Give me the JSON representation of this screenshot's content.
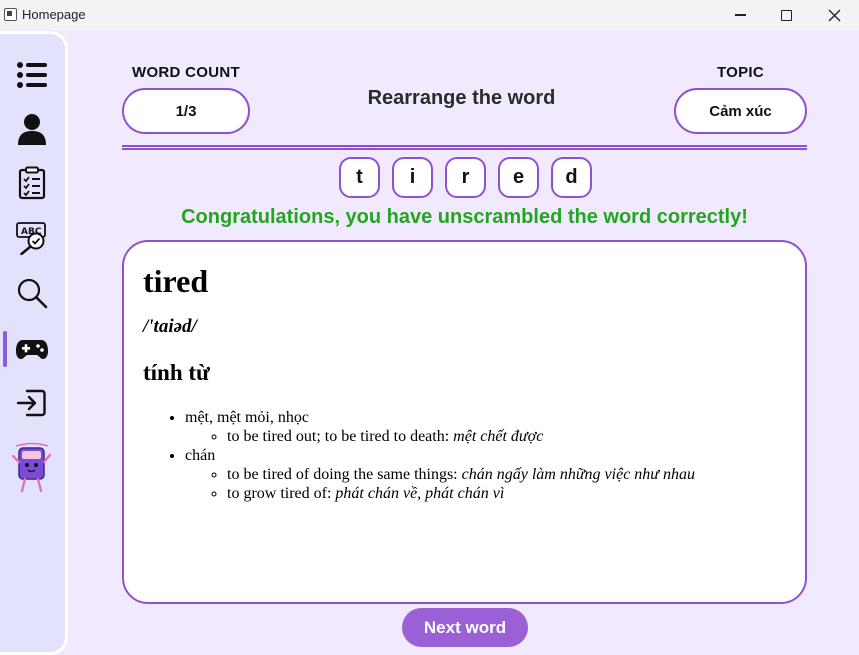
{
  "window": {
    "title": "Homepage"
  },
  "sidebar": {
    "items": [
      {
        "icon": "menu-list-icon"
      },
      {
        "icon": "user-icon"
      },
      {
        "icon": "clipboard-checklist-icon"
      },
      {
        "icon": "spell-check-icon"
      },
      {
        "icon": "search-icon"
      },
      {
        "icon": "gamepad-icon",
        "active": true
      },
      {
        "icon": "logout-icon"
      },
      {
        "icon": "book-mascot-icon"
      }
    ]
  },
  "header": {
    "word_count_label": "WORD COUNT",
    "word_count_value": "1/3",
    "title": "Rearrange the word",
    "topic_label": "TOPIC",
    "topic_value": "Cảm xúc"
  },
  "letters": [
    "t",
    "i",
    "r",
    "e",
    "d"
  ],
  "message": "Congratulations, you have unscrambled the word correctly!",
  "definition": {
    "word": "tired",
    "phonetic": "/'taiəd/",
    "part_of_speech": "tính từ",
    "senses": [
      {
        "meaning": "mệt, mệt mỏi, nhọc",
        "examples": [
          {
            "en": "to be tired out; to be tired to death: ",
            "vi": "mệt chết được"
          }
        ]
      },
      {
        "meaning": "chán",
        "examples": [
          {
            "en": "to be tired of doing the same things: ",
            "vi": "chán ngấy làm những việc như nhau"
          },
          {
            "en": "to grow tired of: ",
            "vi": "phát chán về, phát chán vì"
          }
        ]
      }
    ]
  },
  "next_button": "Next word",
  "colors": {
    "accent": "#8e52d0",
    "success": "#23a61f",
    "background": "#f1e9fd",
    "sidebar": "#e3e2fd",
    "button": "#9b5fd6"
  }
}
